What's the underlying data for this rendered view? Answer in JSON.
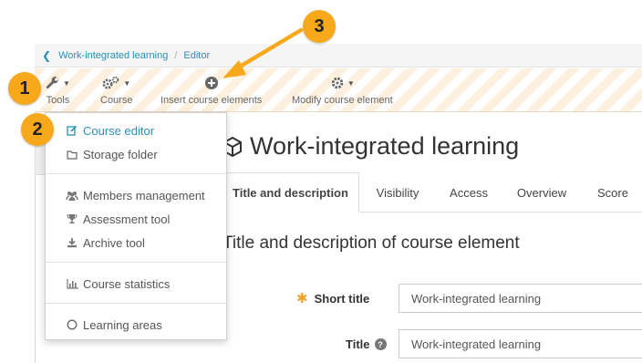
{
  "breadcrumb": {
    "items": [
      "Work-integrated learning",
      "Editor"
    ]
  },
  "toolbar": {
    "tools_label": "Tools",
    "course_label": "Course",
    "insert_label": "Insert course elements",
    "modify_label": "Modify course element"
  },
  "dropdown": {
    "items": [
      {
        "label": "Course editor",
        "icon": "edit-icon",
        "active": true
      },
      {
        "label": "Storage folder",
        "icon": "folder-icon"
      },
      {
        "label": "Members management",
        "icon": "users-icon"
      },
      {
        "label": "Assessment tool",
        "icon": "trophy-icon"
      },
      {
        "label": "Archive tool",
        "icon": "download-icon"
      },
      {
        "label": "Course statistics",
        "icon": "bar-chart-icon"
      },
      {
        "label": "Learning areas",
        "icon": "circle-icon"
      }
    ]
  },
  "course": {
    "title": "Work-integrated learning"
  },
  "tabs": [
    {
      "label": "Title and description",
      "active": true
    },
    {
      "label": "Visibility"
    },
    {
      "label": "Access"
    },
    {
      "label": "Overview"
    },
    {
      "label": "Score"
    }
  ],
  "section": {
    "heading": "Title and description of course element"
  },
  "form": {
    "short_title_label": "Short title",
    "short_title_value": "Work-integrated learning",
    "title_label": "Title",
    "title_value": "Work-integrated learning",
    "help_glyph": "?"
  },
  "callouts": [
    "1",
    "2",
    "3"
  ],
  "colors": {
    "accent": "#2a90b8",
    "callout": "#f7a81b",
    "required": "#f3a42b"
  }
}
